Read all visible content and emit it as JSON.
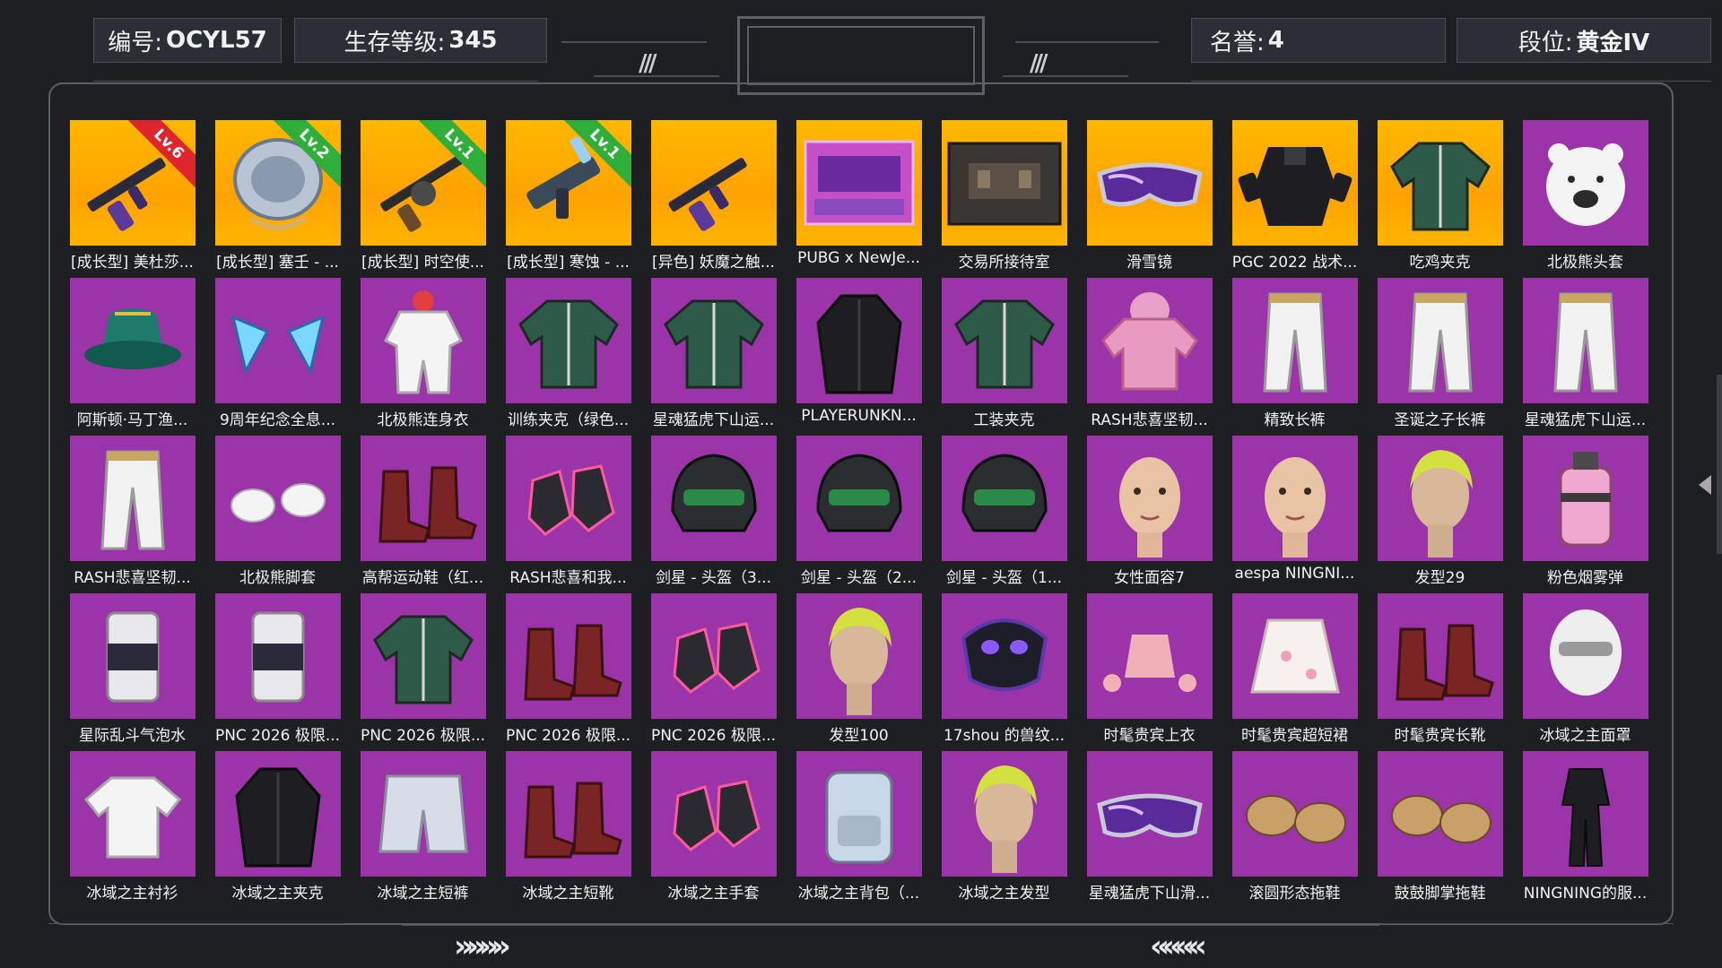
{
  "header": {
    "id_label": "编号:",
    "id_value": "OCYL57",
    "level_label": "生存等级:",
    "level_value": "345",
    "honor_label": "名誉:",
    "honor_value": "4",
    "rank_label": "段位:",
    "rank_value": "黄金IV",
    "left_slashes": "///",
    "right_slashes": "///"
  },
  "footer": {
    "next_arrows": "»»»»",
    "prev_arrows": "««««"
  },
  "colors": {
    "rare_bg": "#9b34a9",
    "legendary_bg": "#ffac00",
    "level_red": "#e0242e",
    "level_green": "#2fae3a"
  },
  "items": [
    {
      "name": "[成长型] 美杜莎...",
      "bg": "gold",
      "badge": "Lv.6",
      "badge_color": "red",
      "icon": "rifle-icon"
    },
    {
      "name": "[成长型] 塞壬 - ...",
      "bg": "gold",
      "badge": "Lv.2",
      "badge_color": "green",
      "icon": "shield-icon"
    },
    {
      "name": "[成长型] 时空使...",
      "bg": "gold",
      "badge": "Lv.1",
      "badge_color": "green",
      "icon": "tommy-gun-icon"
    },
    {
      "name": "[成长型] 寒蚀 - ...",
      "bg": "gold",
      "badge": "Lv.1",
      "badge_color": "green",
      "icon": "smg-icon"
    },
    {
      "name": "[异色] 妖魔之触...",
      "bg": "gold",
      "badge": "",
      "badge_color": "",
      "icon": "rifle-icon"
    },
    {
      "name": "PUBG x NewJe...",
      "bg": "gold",
      "badge": "",
      "badge_color": "",
      "icon": "stage-icon"
    },
    {
      "name": "交易所接待室",
      "bg": "gold",
      "badge": "",
      "badge_color": "",
      "icon": "room-icon"
    },
    {
      "name": "滑雪镜",
      "bg": "gold",
      "badge": "",
      "badge_color": "",
      "icon": "goggles-icon"
    },
    {
      "name": "PGC 2022 战术...",
      "bg": "gold",
      "badge": "",
      "badge_color": "",
      "icon": "vest-icon"
    },
    {
      "name": "吃鸡夹克",
      "bg": "gold",
      "badge": "",
      "badge_color": "",
      "icon": "jacket-icon"
    },
    {
      "name": "北极熊头套",
      "bg": "purple",
      "badge": "",
      "badge_color": "",
      "icon": "bear-head-icon"
    },
    {
      "name": "阿斯顿·马丁渔...",
      "bg": "purple",
      "badge": "",
      "badge_color": "",
      "icon": "bucket-hat-icon"
    },
    {
      "name": "9周年纪念全息...",
      "bg": "purple",
      "badge": "",
      "badge_color": "",
      "icon": "cat-ears-icon"
    },
    {
      "name": "北极熊连身衣",
      "bg": "purple",
      "badge": "",
      "badge_color": "",
      "icon": "jumpsuit-icon"
    },
    {
      "name": "训练夹克（绿色...",
      "bg": "purple",
      "badge": "",
      "badge_color": "",
      "icon": "jacket-icon"
    },
    {
      "name": "星魂猛虎下山运...",
      "bg": "purple",
      "badge": "",
      "badge_color": "",
      "icon": "jacket-icon"
    },
    {
      "name": "PLAYERUNKN...",
      "bg": "purple",
      "badge": "",
      "badge_color": "",
      "icon": "coat-icon"
    },
    {
      "name": "工装夹克",
      "bg": "purple",
      "badge": "",
      "badge_color": "",
      "icon": "jacket-icon"
    },
    {
      "name": "RASH悲喜坚韧...",
      "bg": "purple",
      "badge": "",
      "badge_color": "",
      "icon": "hoodie-icon"
    },
    {
      "name": "精致长裤",
      "bg": "purple",
      "badge": "",
      "badge_color": "",
      "icon": "pants-icon"
    },
    {
      "name": "圣诞之子长裤",
      "bg": "purple",
      "badge": "",
      "badge_color": "",
      "icon": "pants-icon"
    },
    {
      "name": "星魂猛虎下山运...",
      "bg": "purple",
      "badge": "",
      "badge_color": "",
      "icon": "pants-icon"
    },
    {
      "name": "RASH悲喜坚韧...",
      "bg": "purple",
      "badge": "",
      "badge_color": "",
      "icon": "pants-icon"
    },
    {
      "name": "北极熊脚套",
      "bg": "purple",
      "badge": "",
      "badge_color": "",
      "icon": "paws-icon"
    },
    {
      "name": "高帮运动鞋（红...",
      "bg": "purple",
      "badge": "",
      "badge_color": "",
      "icon": "boots-icon"
    },
    {
      "name": "RASH悲喜和我...",
      "bg": "purple",
      "badge": "",
      "badge_color": "",
      "icon": "gloves-icon"
    },
    {
      "name": "剑星 - 头盔（3...",
      "bg": "purple",
      "badge": "",
      "badge_color": "",
      "icon": "helmet-icon"
    },
    {
      "name": "剑星 - 头盔（2...",
      "bg": "purple",
      "badge": "",
      "badge_color": "",
      "icon": "helmet-icon"
    },
    {
      "name": "剑星 - 头盔（1...",
      "bg": "purple",
      "badge": "",
      "badge_color": "",
      "icon": "helmet-icon"
    },
    {
      "name": "女性面容7",
      "bg": "purple",
      "badge": "",
      "badge_color": "",
      "icon": "face-icon"
    },
    {
      "name": "aespa NINGNI...",
      "bg": "purple",
      "badge": "",
      "badge_color": "",
      "icon": "face-icon"
    },
    {
      "name": "发型29",
      "bg": "purple",
      "badge": "",
      "badge_color": "",
      "icon": "hair-icon"
    },
    {
      "name": "粉色烟雾弹",
      "bg": "purple",
      "badge": "",
      "badge_color": "",
      "icon": "grenade-icon"
    },
    {
      "name": "星际乱斗气泡水",
      "bg": "purple",
      "badge": "",
      "badge_color": "",
      "icon": "can-icon"
    },
    {
      "name": "PNC 2026 极限...",
      "bg": "purple",
      "badge": "",
      "badge_color": "",
      "icon": "can-icon"
    },
    {
      "name": "PNC 2026 极限...",
      "bg": "purple",
      "badge": "",
      "badge_color": "",
      "icon": "jacket-icon"
    },
    {
      "name": "PNC 2026 极限...",
      "bg": "purple",
      "badge": "",
      "badge_color": "",
      "icon": "boots-icon"
    },
    {
      "name": "PNC 2026 极限...",
      "bg": "purple",
      "badge": "",
      "badge_color": "",
      "icon": "gloves-icon"
    },
    {
      "name": "发型100",
      "bg": "purple",
      "badge": "",
      "badge_color": "",
      "icon": "hair-icon"
    },
    {
      "name": "17shou 的兽纹...",
      "bg": "purple",
      "badge": "",
      "badge_color": "",
      "icon": "mask-icon"
    },
    {
      "name": "时髦贵宾上衣",
      "bg": "purple",
      "badge": "",
      "badge_color": "",
      "icon": "top-icon"
    },
    {
      "name": "时髦贵宾超短裙",
      "bg": "purple",
      "badge": "",
      "badge_color": "",
      "icon": "skirt-icon"
    },
    {
      "name": "时髦贵宾长靴",
      "bg": "purple",
      "badge": "",
      "badge_color": "",
      "icon": "boots-icon"
    },
    {
      "name": "冰域之主面罩",
      "bg": "purple",
      "badge": "",
      "badge_color": "",
      "icon": "balaclava-icon"
    },
    {
      "name": "冰域之主衬衫",
      "bg": "purple",
      "badge": "",
      "badge_color": "",
      "icon": "shirt-icon"
    },
    {
      "name": "冰域之主夹克",
      "bg": "purple",
      "badge": "",
      "badge_color": "",
      "icon": "coat-icon"
    },
    {
      "name": "冰域之主短裤",
      "bg": "purple",
      "badge": "",
      "badge_color": "",
      "icon": "shorts-icon"
    },
    {
      "name": "冰域之主短靴",
      "bg": "purple",
      "badge": "",
      "badge_color": "",
      "icon": "boots-icon"
    },
    {
      "name": "冰域之主手套",
      "bg": "purple",
      "badge": "",
      "badge_color": "",
      "icon": "gloves-icon"
    },
    {
      "name": "冰域之主背包（...",
      "bg": "purple",
      "badge": "",
      "badge_color": "",
      "icon": "backpack-icon"
    },
    {
      "name": "冰域之主发型",
      "bg": "purple",
      "badge": "",
      "badge_color": "",
      "icon": "hair-icon"
    },
    {
      "name": "星魂猛虎下山滑...",
      "bg": "purple",
      "badge": "",
      "badge_color": "",
      "icon": "goggles-icon"
    },
    {
      "name": "滚圆形态拖鞋",
      "bg": "purple",
      "badge": "",
      "badge_color": "",
      "icon": "slippers-icon"
    },
    {
      "name": "鼓鼓脚掌拖鞋",
      "bg": "purple",
      "badge": "",
      "badge_color": "",
      "icon": "slippers-icon"
    },
    {
      "name": "NINGNING的服...",
      "bg": "purple",
      "badge": "",
      "badge_color": "",
      "icon": "outfit-icon"
    }
  ]
}
